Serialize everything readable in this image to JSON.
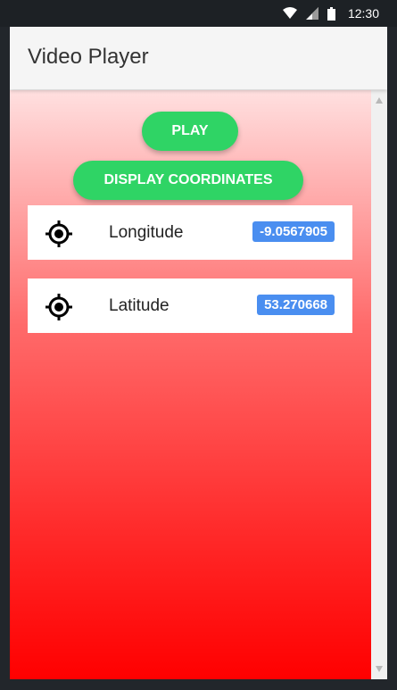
{
  "status_bar": {
    "time": "12:30",
    "icons": [
      "wifi-icon",
      "signal-icon",
      "battery-icon"
    ]
  },
  "app_bar": {
    "title": "Video Player"
  },
  "buttons": {
    "play_label": "PLAY",
    "display_coordinates_label": "DISPLAY COORDINATES"
  },
  "coordinates": [
    {
      "icon": "target-icon",
      "label": "Longitude",
      "value": "-9.0567905"
    },
    {
      "icon": "target-icon",
      "label": "Latitude",
      "value": "53.270668"
    }
  ],
  "colors": {
    "button_green": "#2fd465",
    "badge_blue": "#4a8ef0",
    "gradient_top": "#ffe0e0",
    "gradient_bottom": "#ff0000"
  }
}
